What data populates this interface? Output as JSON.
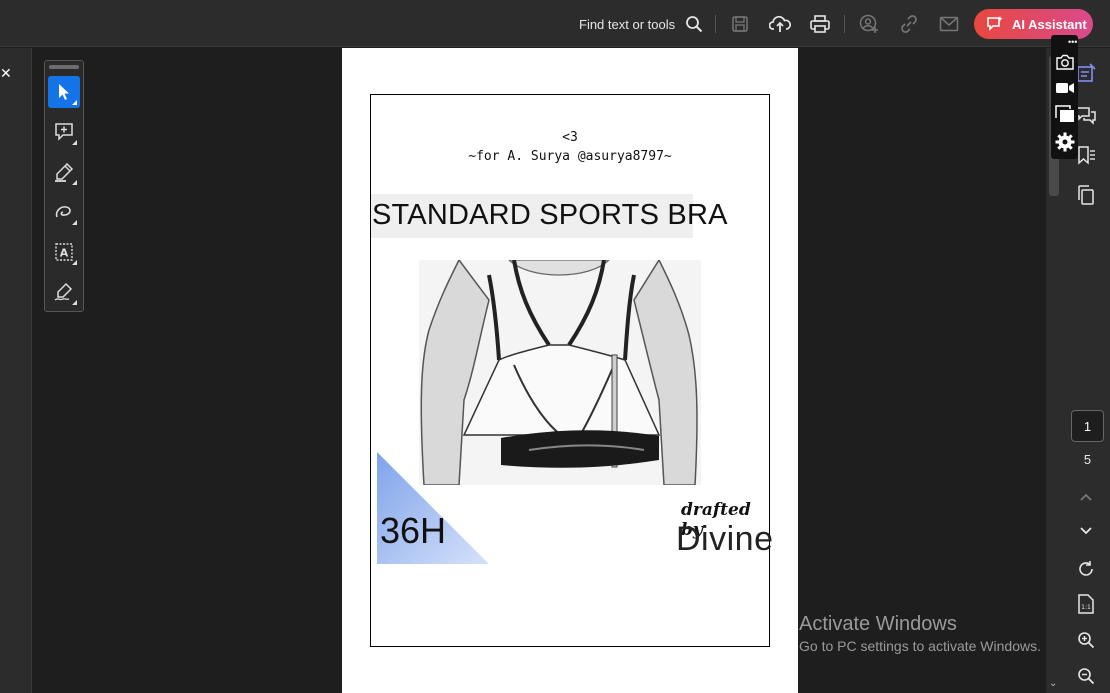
{
  "toolbar": {
    "find_label": "Find text or tools",
    "ai_label": "AI Assistant"
  },
  "left_tools": [
    {
      "name": "select-tool",
      "icon": "cursor-arrow-icon",
      "active": true
    },
    {
      "name": "comment-tool",
      "icon": "add-comment-icon",
      "active": false
    },
    {
      "name": "highlight-tool",
      "icon": "pen-highlight-icon",
      "active": false
    },
    {
      "name": "draw-tool",
      "icon": "freehand-loop-icon",
      "active": false
    },
    {
      "name": "text-recognition-tool",
      "icon": "text-select-box-icon",
      "active": false
    },
    {
      "name": "sign-tool",
      "icon": "signature-pen-icon",
      "active": false
    }
  ],
  "document": {
    "heart": "<3",
    "dedication": "~for A. Surya @asurya8797~",
    "title": "STANDARD SPORTS BRA",
    "size": "36H",
    "drafted_by": "drafted by",
    "brand": "Divine"
  },
  "navigation": {
    "current_page": "1",
    "total_pages": "5"
  },
  "watermark": {
    "line1": "Activate Windows",
    "line2": "Go to PC settings to activate Windows."
  },
  "colors": {
    "accent": "#1473e6",
    "ai_gradient_start": "#e8483f",
    "ai_gradient_end": "#d94a8c",
    "triangle_blue": "#a9c3f0"
  }
}
